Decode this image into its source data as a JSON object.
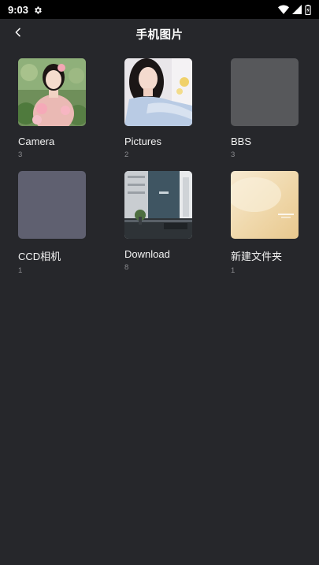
{
  "status_bar": {
    "time": "9:03",
    "settings_icon": "gear-icon",
    "wifi_icon": "wifi-icon",
    "signal_icon": "signal-icon",
    "battery_icon": "battery-icon"
  },
  "header": {
    "back_icon": "chevron-left-icon",
    "title": "手机图片"
  },
  "albums": [
    {
      "name": "Camera",
      "count": "3",
      "thumb": "portrait-flowers"
    },
    {
      "name": "Pictures",
      "count": "2",
      "thumb": "portrait-light"
    },
    {
      "name": "BBS",
      "count": "3",
      "thumb": "empty-gray"
    },
    {
      "name": "CCD相机",
      "count": "1",
      "thumb": "empty-slate"
    },
    {
      "name": "Download",
      "count": "8",
      "thumb": "building-interior"
    },
    {
      "name": "新建文件夹",
      "count": "1",
      "thumb": "beige-texture"
    }
  ],
  "colors": {
    "background": "#26272b",
    "status_bar": "#000000",
    "text_primary": "#f2f2f2",
    "text_secondary": "#8a8b8f",
    "placeholder_gray": "#57585b",
    "placeholder_slate": "#5f6070"
  }
}
